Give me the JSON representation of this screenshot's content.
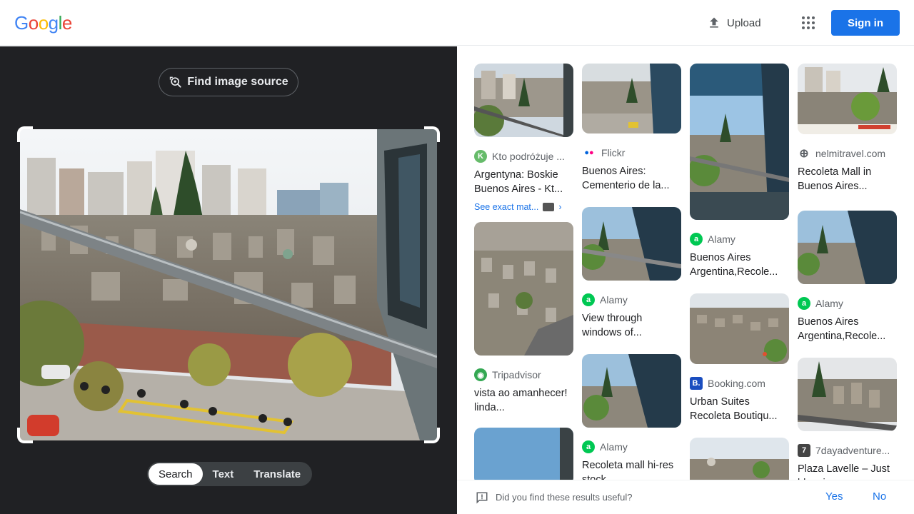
{
  "header": {
    "logo_letters": [
      "G",
      "o",
      "o",
      "g",
      "l",
      "e"
    ],
    "logo_colors": [
      "#4285f4",
      "#ea4335",
      "#fbbc05",
      "#4285f4",
      "#34a853",
      "#ea4335"
    ],
    "upload_label": "Upload",
    "apps_icon": "apps-grid-icon",
    "signin_label": "Sign in"
  },
  "left_pane": {
    "find_source_label": "Find image source",
    "tabs": [
      {
        "label": "Search",
        "active": true
      },
      {
        "label": "Text",
        "active": false
      },
      {
        "label": "Translate",
        "active": false
      }
    ]
  },
  "results": {
    "columns": [
      [
        {
          "source": "Kto podróżuje ...",
          "title": "Argentyna: Boskie Buenos Aires - Kt...",
          "fav": "K",
          "fav_color": "#66bb6a",
          "exact_label": "See exact mat..."
        },
        {
          "source": "Tripadvisor",
          "title": "vista ao amanhecer! linda...",
          "fav": "◉",
          "fav_color": "#34a853"
        },
        {
          "source": "",
          "title": "",
          "fav": "",
          "fav_color": ""
        }
      ],
      [
        {
          "source": "Flickr",
          "title": "Buenos Aires: Cementerio de la...",
          "fav": "••",
          "fav_color": "#ffffff"
        },
        {
          "source": "Alamy",
          "title": "View through windows of...",
          "fav": "a",
          "fav_color": "#00c853"
        },
        {
          "source": "Alamy",
          "title": "Recoleta mall hi-res stock...",
          "fav": "a",
          "fav_color": "#00c853"
        }
      ],
      [
        {
          "source": "Alamy",
          "title": "Buenos Aires Argentina,Recole...",
          "fav": "a",
          "fav_color": "#00c853"
        },
        {
          "source": "Booking.com",
          "title": "Urban Suites Recoleta Boutiqu...",
          "fav": "B.",
          "fav_color": "#1a4dbf"
        },
        {
          "source": "",
          "title": "",
          "fav": "",
          "fav_color": ""
        }
      ],
      [
        {
          "source": "nelmitravel.com",
          "title": "Recoleta Mall in Buenos Aires...",
          "fav": "⊕",
          "fav_color": "#5f6368"
        },
        {
          "source": "Alamy",
          "title": "Buenos Aires Argentina,Recole...",
          "fav": "a",
          "fav_color": "#00c853"
        },
        {
          "source": "7dayadventure...",
          "title": "Plaza Lavelle – Just blogging away ......",
          "fav": "7",
          "fav_color": "#444444"
        }
      ]
    ]
  },
  "feedback": {
    "question": "Did you find these results useful?",
    "yes_label": "Yes",
    "no_label": "No"
  }
}
